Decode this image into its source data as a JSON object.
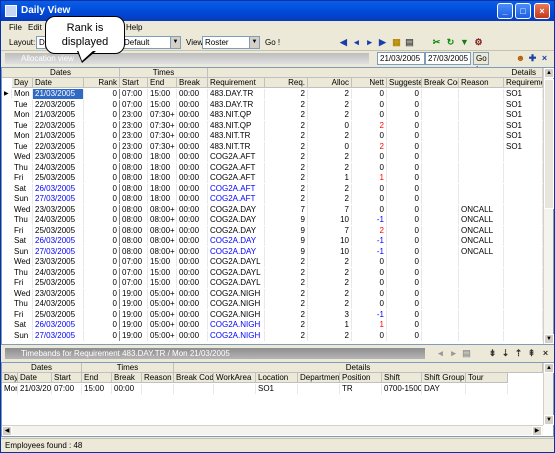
{
  "window": {
    "title": "Daily View"
  },
  "menu": {
    "file": "File",
    "edit": "Edit",
    "help": "Help"
  },
  "callout": {
    "text": "Rank is displayed"
  },
  "toolbar": {
    "layout_label": "Layout:",
    "layout_value": "D",
    "profile_value": "Default",
    "view_label": "View",
    "view_value": "Roster",
    "go_label": "Go !"
  },
  "allocation": {
    "caption": "Allocation view",
    "date_from": "21/03/2005",
    "date_to": "27/03/2005",
    "go_label": "Go !"
  },
  "grid1": {
    "groups": {
      "dates": "Dates",
      "times": "Times",
      "details": "Details"
    },
    "columns": [
      "Day",
      "Date",
      "Rank",
      "Start",
      "End",
      "Break",
      "Requirement",
      "Req.",
      "Alloc",
      "Nett",
      "Suggested",
      "Break Code",
      "Reason",
      "Requireme..."
    ],
    "rows": [
      {
        "day": "Mon",
        "date": "21/03/2005",
        "rank": "0",
        "start": "07:00",
        "end": "15:00",
        "brk": "00:00",
        "req": "483.DAY.TR",
        "reqn": "2",
        "alloc": "2",
        "nett": "0",
        "sugg": "0",
        "bcode": "",
        "reason": "",
        "reqm": "SO1",
        "date_blue": false,
        "req_blue": false,
        "nett_red": false,
        "current": true
      },
      {
        "day": "Tue",
        "date": "22/03/2005",
        "rank": "0",
        "start": "07:00",
        "end": "15:00",
        "brk": "00:00",
        "req": "483.DAY.TR",
        "reqn": "2",
        "alloc": "2",
        "nett": "0",
        "sugg": "0",
        "bcode": "",
        "reason": "",
        "reqm": "SO1",
        "date_blue": false,
        "req_blue": false,
        "nett_red": false,
        "current": false
      },
      {
        "day": "Mon",
        "date": "21/03/2005",
        "rank": "0",
        "start": "23:00",
        "end": "07:30+",
        "brk": "00:00",
        "req": "483.NIT.QP",
        "reqn": "2",
        "alloc": "2",
        "nett": "0",
        "sugg": "0",
        "bcode": "",
        "reason": "",
        "reqm": "SO1",
        "date_blue": false,
        "req_blue": false,
        "nett_red": false,
        "current": false
      },
      {
        "day": "Tue",
        "date": "22/03/2005",
        "rank": "0",
        "start": "23:00",
        "end": "07:30+",
        "brk": "00:00",
        "req": "483.NIT.QP",
        "reqn": "2",
        "alloc": "0",
        "nett": "2",
        "sugg": "0",
        "bcode": "",
        "reason": "",
        "reqm": "SO1",
        "date_blue": false,
        "req_blue": false,
        "nett_red": true,
        "current": false
      },
      {
        "day": "Mon",
        "date": "21/03/2005",
        "rank": "0",
        "start": "23:00",
        "end": "07:30+",
        "brk": "00:00",
        "req": "483.NIT.TR",
        "reqn": "2",
        "alloc": "2",
        "nett": "0",
        "sugg": "0",
        "bcode": "",
        "reason": "",
        "reqm": "SO1",
        "date_blue": false,
        "req_blue": false,
        "nett_red": false,
        "current": false
      },
      {
        "day": "Tue",
        "date": "22/03/2005",
        "rank": "0",
        "start": "23:00",
        "end": "07:30+",
        "brk": "00:00",
        "req": "483.NIT.TR",
        "reqn": "2",
        "alloc": "0",
        "nett": "2",
        "sugg": "0",
        "bcode": "",
        "reason": "",
        "reqm": "SO1",
        "date_blue": false,
        "req_blue": false,
        "nett_red": true,
        "current": false
      },
      {
        "day": "Wed",
        "date": "23/03/2005",
        "rank": "0",
        "start": "08:00",
        "end": "18:00",
        "brk": "00:00",
        "req": "COG2A.AFT",
        "reqn": "2",
        "alloc": "2",
        "nett": "0",
        "sugg": "0",
        "bcode": "",
        "reason": "",
        "reqm": "",
        "date_blue": false,
        "req_blue": false,
        "nett_red": false,
        "current": false
      },
      {
        "day": "Thu",
        "date": "24/03/2005",
        "rank": "0",
        "start": "08:00",
        "end": "18:00",
        "brk": "00:00",
        "req": "COG2A.AFT",
        "reqn": "2",
        "alloc": "2",
        "nett": "0",
        "sugg": "0",
        "bcode": "",
        "reason": "",
        "reqm": "",
        "date_blue": false,
        "req_blue": false,
        "nett_red": false,
        "current": false
      },
      {
        "day": "Fri",
        "date": "25/03/2005",
        "rank": "0",
        "start": "08:00",
        "end": "18:00",
        "brk": "00:00",
        "req": "COG2A.AFT",
        "reqn": "2",
        "alloc": "1",
        "nett": "1",
        "sugg": "0",
        "bcode": "",
        "reason": "",
        "reqm": "",
        "date_blue": false,
        "req_blue": false,
        "nett_red": true,
        "current": false
      },
      {
        "day": "Sat",
        "date": "26/03/2005",
        "rank": "0",
        "start": "08:00",
        "end": "18:00",
        "brk": "00:00",
        "req": "COG2A.AFT",
        "reqn": "2",
        "alloc": "2",
        "nett": "0",
        "sugg": "0",
        "bcode": "",
        "reason": "",
        "reqm": "",
        "date_blue": true,
        "req_blue": true,
        "nett_red": false,
        "current": false
      },
      {
        "day": "Sun",
        "date": "27/03/2005",
        "rank": "0",
        "start": "08:00",
        "end": "18:00",
        "brk": "00:00",
        "req": "COG2A.AFT",
        "reqn": "2",
        "alloc": "2",
        "nett": "0",
        "sugg": "0",
        "bcode": "",
        "reason": "",
        "reqm": "",
        "date_blue": true,
        "req_blue": true,
        "nett_red": false,
        "current": false
      },
      {
        "day": "Wed",
        "date": "23/03/2005",
        "rank": "0",
        "start": "08:00",
        "end": "08:00+",
        "brk": "00:00",
        "req": "COG2A.DAY",
        "reqn": "7",
        "alloc": "7",
        "nett": "0",
        "sugg": "0",
        "bcode": "",
        "reason": "ONCALL",
        "reqm": "",
        "date_blue": false,
        "req_blue": false,
        "nett_red": false,
        "current": false
      },
      {
        "day": "Thu",
        "date": "24/03/2005",
        "rank": "0",
        "start": "08:00",
        "end": "08:00+",
        "brk": "00:00",
        "req": "COG2A.DAY",
        "reqn": "9",
        "alloc": "10",
        "nett": "-1",
        "sugg": "0",
        "bcode": "",
        "reason": "ONCALL",
        "reqm": "",
        "date_blue": false,
        "req_blue": false,
        "nett_red": false,
        "nett_blue": true,
        "current": false
      },
      {
        "day": "Fri",
        "date": "25/03/2005",
        "rank": "0",
        "start": "08:00",
        "end": "08:00+",
        "brk": "00:00",
        "req": "COG2A.DAY",
        "reqn": "9",
        "alloc": "7",
        "nett": "2",
        "sugg": "0",
        "bcode": "",
        "reason": "ONCALL",
        "reqm": "",
        "date_blue": false,
        "req_blue": false,
        "nett_red": true,
        "current": false
      },
      {
        "day": "Sat",
        "date": "26/03/2005",
        "rank": "0",
        "start": "08:00",
        "end": "08:00+",
        "brk": "00:00",
        "req": "COG2A.DAY",
        "reqn": "9",
        "alloc": "10",
        "nett": "-1",
        "sugg": "0",
        "bcode": "",
        "reason": "ONCALL",
        "reqm": "",
        "date_blue": true,
        "req_blue": true,
        "nett_red": false,
        "nett_blue": true,
        "current": false
      },
      {
        "day": "Sun",
        "date": "27/03/2005",
        "rank": "0",
        "start": "08:00",
        "end": "08:00+",
        "brk": "00:00",
        "req": "COG2A.DAY",
        "reqn": "9",
        "alloc": "10",
        "nett": "-1",
        "sugg": "0",
        "bcode": "",
        "reason": "ONCALL",
        "reqm": "",
        "date_blue": true,
        "req_blue": true,
        "nett_red": false,
        "nett_blue": true,
        "current": false
      },
      {
        "day": "Wed",
        "date": "23/03/2005",
        "rank": "0",
        "start": "07:00",
        "end": "15:00",
        "brk": "00:00",
        "req": "COG2A.DAYL",
        "reqn": "2",
        "alloc": "2",
        "nett": "0",
        "sugg": "0",
        "bcode": "",
        "reason": "",
        "reqm": "",
        "date_blue": false,
        "req_blue": false,
        "nett_red": false,
        "current": false
      },
      {
        "day": "Thu",
        "date": "24/03/2005",
        "rank": "0",
        "start": "07:00",
        "end": "15:00",
        "brk": "00:00",
        "req": "COG2A.DAYL",
        "reqn": "2",
        "alloc": "2",
        "nett": "0",
        "sugg": "0",
        "bcode": "",
        "reason": "",
        "reqm": "",
        "date_blue": false,
        "req_blue": false,
        "nett_red": false,
        "current": false
      },
      {
        "day": "Fri",
        "date": "25/03/2005",
        "rank": "0",
        "start": "07:00",
        "end": "15:00",
        "brk": "00:00",
        "req": "COG2A.DAYL",
        "reqn": "2",
        "alloc": "2",
        "nett": "0",
        "sugg": "0",
        "bcode": "",
        "reason": "",
        "reqm": "",
        "date_blue": false,
        "req_blue": false,
        "nett_red": false,
        "current": false
      },
      {
        "day": "Wed",
        "date": "23/03/2005",
        "rank": "0",
        "start": "19:00",
        "end": "05:00+",
        "brk": "00:00",
        "req": "COG2A.NIGH",
        "reqn": "2",
        "alloc": "2",
        "nett": "0",
        "sugg": "0",
        "bcode": "",
        "reason": "",
        "reqm": "",
        "date_blue": false,
        "req_blue": false,
        "nett_red": false,
        "current": false
      },
      {
        "day": "Thu",
        "date": "24/03/2005",
        "rank": "0",
        "start": "19:00",
        "end": "05:00+",
        "brk": "00:00",
        "req": "COG2A.NIGH",
        "reqn": "2",
        "alloc": "2",
        "nett": "0",
        "sugg": "0",
        "bcode": "",
        "reason": "",
        "reqm": "",
        "date_blue": false,
        "req_blue": false,
        "nett_red": false,
        "current": false
      },
      {
        "day": "Fri",
        "date": "25/03/2005",
        "rank": "0",
        "start": "19:00",
        "end": "05:00+",
        "brk": "00:00",
        "req": "COG2A.NIGH",
        "reqn": "2",
        "alloc": "3",
        "nett": "-1",
        "sugg": "0",
        "bcode": "",
        "reason": "",
        "reqm": "",
        "date_blue": false,
        "req_blue": false,
        "nett_red": false,
        "nett_blue": true,
        "current": false
      },
      {
        "day": "Sat",
        "date": "26/03/2005",
        "rank": "0",
        "start": "19:00",
        "end": "05:00+",
        "brk": "00:00",
        "req": "COG2A.NIGH",
        "reqn": "2",
        "alloc": "1",
        "nett": "1",
        "sugg": "0",
        "bcode": "",
        "reason": "",
        "reqm": "",
        "date_blue": true,
        "req_blue": true,
        "nett_red": true,
        "current": false
      },
      {
        "day": "Sun",
        "date": "27/03/2005",
        "rank": "0",
        "start": "19:00",
        "end": "05:00+",
        "brk": "00:00",
        "req": "COG2A.NIGH",
        "reqn": "2",
        "alloc": "2",
        "nett": "0",
        "sugg": "0",
        "bcode": "",
        "reason": "",
        "reqm": "",
        "date_blue": true,
        "req_blue": true,
        "nett_red": false,
        "current": false
      }
    ]
  },
  "timebands": {
    "caption": "Timebands for Requirement 483.DAY.TR / Mon 21/03/2005",
    "groups": {
      "dates": "Dates",
      "times": "Times",
      "details": "Details"
    },
    "columns": [
      "Day",
      "Date",
      "Start",
      "End",
      "Break",
      "Reason",
      "Break Code",
      "WorkArea",
      "Location",
      "Department",
      "Position",
      "Shift",
      "Shift Group",
      "Tour"
    ],
    "row": {
      "day": "Mon",
      "date": "21/03/2005",
      "start": "07:00",
      "end": "15:00",
      "brk": "00:00",
      "reason": "",
      "bcode": "",
      "workarea": "",
      "location": "SO1",
      "department": "",
      "position": "TR",
      "shift": "0700-1500",
      "shiftgroup": "DAY",
      "tour": ""
    }
  },
  "status": {
    "text": "Employees found : 48"
  }
}
